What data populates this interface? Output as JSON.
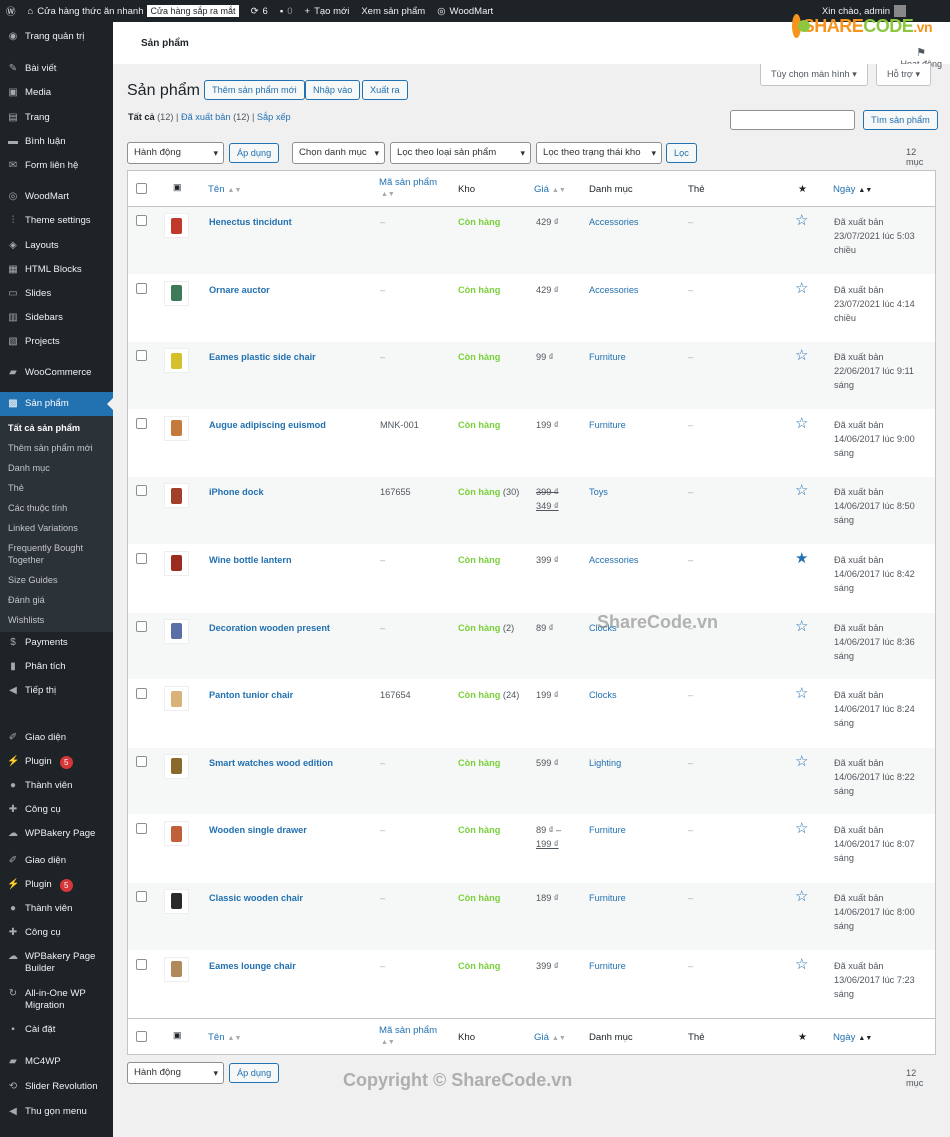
{
  "adminbar": {
    "site_name": "Cửa hàng thức ăn nhanh",
    "status_badge": "Cửa hàng sắp ra mắt",
    "updates_count": "6",
    "comments_count": "0",
    "new_label": "Tạo mới",
    "view_products": "Xem sản phẩm",
    "woodmart": "WoodMart",
    "greeting": "Xin chào, admin"
  },
  "sidebar": {
    "items": [
      {
        "label": "Trang quản trị",
        "icon": "dashboard-icon"
      },
      {
        "label": "Bài viết",
        "icon": "pin-icon"
      },
      {
        "label": "Media",
        "icon": "media-icon"
      },
      {
        "label": "Trang",
        "icon": "page-icon"
      },
      {
        "label": "Bình luận",
        "icon": "comment-icon"
      },
      {
        "label": "Form liên hệ",
        "icon": "mail-icon"
      },
      {
        "label": "WoodMart",
        "icon": "woodmart-icon"
      },
      {
        "label": "Theme settings",
        "icon": "sliders-icon"
      },
      {
        "label": "Layouts",
        "icon": "layers-icon"
      },
      {
        "label": "HTML Blocks",
        "icon": "blocks-icon"
      },
      {
        "label": "Slides",
        "icon": "slides-icon"
      },
      {
        "label": "Sidebars",
        "icon": "sidebars-icon"
      },
      {
        "label": "Projects",
        "icon": "projects-icon"
      },
      {
        "label": "WooCommerce",
        "icon": "woo-icon"
      },
      {
        "label": "Sản phẩm",
        "icon": "archive-icon"
      }
    ],
    "submenu": [
      "Tất cả sản phẩm",
      "Thêm sản phẩm mới",
      "Danh mục",
      "Thẻ",
      "Các thuộc tính",
      "Linked Variations",
      "Frequently Bought Together",
      "Size Guides",
      "Đánh giá",
      "Wishlists"
    ],
    "items2": [
      {
        "label": "Payments",
        "icon": "dollar-icon"
      },
      {
        "label": "Phân tích",
        "icon": "chart-icon"
      },
      {
        "label": "Tiếp thị",
        "icon": "megaphone-icon"
      },
      {
        "label": "Giao diện",
        "icon": "brush-icon"
      },
      {
        "label": "Plugin",
        "icon": "plugin-icon",
        "badge": "5"
      },
      {
        "label": "Thành viên",
        "icon": "user-icon"
      },
      {
        "label": "Công cụ",
        "icon": "wrench-icon"
      },
      {
        "label": "WPBakery Page",
        "icon": "cloud-icon"
      },
      {
        "label": "Giao diện",
        "icon": "brush-icon"
      },
      {
        "label": "Plugin",
        "icon": "plugin-icon",
        "badge": "5"
      },
      {
        "label": "Thành viên",
        "icon": "user-icon"
      },
      {
        "label": "Công cụ",
        "icon": "wrench-icon"
      },
      {
        "label": "WPBakery Page Builder",
        "icon": "cloud-icon"
      },
      {
        "label": "All-in-One WP Migration",
        "icon": "migration-icon"
      },
      {
        "label": "Cài đặt",
        "icon": "settings-icon"
      },
      {
        "label": "MC4WP",
        "icon": "mc4wp-icon"
      },
      {
        "label": "Slider Revolution",
        "icon": "revolution-icon"
      },
      {
        "label": "Thu gọn menu",
        "icon": "collapse-icon"
      }
    ]
  },
  "header": {
    "title": "Sản phẩm",
    "activity": "Hoạt động"
  },
  "logo": {
    "text_a": "SHARE",
    "text_b": "CODE",
    "suffix": ".vn"
  },
  "page": {
    "title": "Sản phẩm",
    "add_new": "Thêm sản phẩm mới",
    "import": "Nhập vào",
    "export": "Xuất ra",
    "screen_options": "Tùy chọn màn hình",
    "help": "Hỗ trợ",
    "views": {
      "all": "Tất cả",
      "all_count": "(12)",
      "published": "Đã xuất bản",
      "published_count": "(12)",
      "sort": "Sắp xếp"
    },
    "search_button": "Tìm sản phẩm",
    "bulk_action": "Hành động",
    "apply": "Áp dụng",
    "category_filter": "Chọn danh mục",
    "type_filter": "Lọc theo loại sản phẩm",
    "stock_filter": "Lọc theo trạng thái kho",
    "filter_button": "Lọc",
    "items_count": "12 mục"
  },
  "table": {
    "headers": {
      "name": "Tên",
      "sku": "Mã sản phẩm",
      "stock": "Kho",
      "price": "Giá",
      "categories": "Danh mục",
      "tags": "Thẻ",
      "date": "Ngày"
    },
    "rows": [
      {
        "name": "Henectus tincidunt",
        "sku": "–",
        "stock": "Còn hàng",
        "stock_qty": "",
        "price": "429 ₫",
        "price2": "",
        "sale": false,
        "category": "Accessories",
        "tags": "–",
        "featured": false,
        "date1": "Đã xuất bản",
        "date2": "23/07/2021 lúc 5:03",
        "date3": "chiều",
        "thumb_color": "#c0392b"
      },
      {
        "name": "Ornare auctor",
        "sku": "–",
        "stock": "Còn hàng",
        "stock_qty": "",
        "price": "429 ₫",
        "price2": "",
        "sale": false,
        "category": "Accessories",
        "tags": "–",
        "featured": false,
        "date1": "Đã xuất bản",
        "date2": "23/07/2021 lúc 4:14",
        "date3": "chiều",
        "thumb_color": "#3c7a5a"
      },
      {
        "name": "Eames plastic side chair",
        "sku": "–",
        "stock": "Còn hàng",
        "stock_qty": "",
        "price": "99 ₫",
        "price2": "",
        "sale": false,
        "category": "Furniture",
        "tags": "–",
        "featured": false,
        "date1": "Đã xuất bản",
        "date2": "22/06/2017 lúc 9:11",
        "date3": "sáng",
        "thumb_color": "#d4c02a"
      },
      {
        "name": "Augue adipiscing euismod",
        "sku": "MNK-001",
        "stock": "Còn hàng",
        "stock_qty": "",
        "price": "199 ₫",
        "price2": "",
        "sale": false,
        "category": "Furniture",
        "tags": "–",
        "featured": false,
        "date1": "Đã xuất bản",
        "date2": "14/06/2017 lúc 9:00",
        "date3": "sáng",
        "thumb_color": "#c47a3a"
      },
      {
        "name": "iPhone dock",
        "sku": "167655",
        "stock": "Còn hàng",
        "stock_qty": "(30)",
        "price": "399 ₫",
        "price2": "349 ₫",
        "sale": true,
        "category": "Toys",
        "tags": "–",
        "featured": false,
        "date1": "Đã xuất bản",
        "date2": "14/06/2017 lúc 8:50",
        "date3": "sáng",
        "thumb_color": "#a0402a"
      },
      {
        "name": "Wine bottle lantern",
        "sku": "–",
        "stock": "Còn hàng",
        "stock_qty": "",
        "price": "399 ₫",
        "price2": "",
        "sale": false,
        "category": "Accessories",
        "tags": "–",
        "featured": true,
        "date1": "Đã xuất bản",
        "date2": "14/06/2017 lúc 8:42",
        "date3": "sáng",
        "thumb_color": "#9b2d20"
      },
      {
        "name": "Decoration wooden present",
        "sku": "–",
        "stock": "Còn hàng",
        "stock_qty": "(2)",
        "price": "89 ₫",
        "price2": "",
        "sale": false,
        "category": "Clocks",
        "tags": "–",
        "featured": false,
        "date1": "Đã xuất bản",
        "date2": "14/06/2017 lúc 8:36",
        "date3": "sáng",
        "thumb_color": "#5a6fa8"
      },
      {
        "name": "Panton tunior chair",
        "sku": "167654",
        "stock": "Còn hàng",
        "stock_qty": "(24)",
        "price": "199 ₫",
        "price2": "",
        "sale": false,
        "category": "Clocks",
        "tags": "–",
        "featured": false,
        "date1": "Đã xuất bản",
        "date2": "14/06/2017 lúc 8:24",
        "date3": "sáng",
        "thumb_color": "#d9b27a"
      },
      {
        "name": "Smart watches wood edition",
        "sku": "–",
        "stock": "Còn hàng",
        "stock_qty": "",
        "price": "599 ₫",
        "price2": "",
        "sale": false,
        "category": "Lighting",
        "tags": "–",
        "featured": false,
        "date1": "Đã xuất bản",
        "date2": "14/06/2017 lúc 8:22",
        "date3": "sáng",
        "thumb_color": "#8a6a2a"
      },
      {
        "name": "Wooden single drawer",
        "sku": "–",
        "stock": "Còn hàng",
        "stock_qty": "",
        "price": "89 ₫ –",
        "price2": "199 ₫",
        "sale": false,
        "category": "Furniture",
        "tags": "–",
        "featured": false,
        "date1": "Đã xuất bản",
        "date2": "14/06/2017 lúc 8:07",
        "date3": "sáng",
        "thumb_color": "#c0603a"
      },
      {
        "name": "Classic wooden chair",
        "sku": "–",
        "stock": "Còn hàng",
        "stock_qty": "",
        "price": "189 ₫",
        "price2": "",
        "sale": false,
        "category": "Furniture",
        "tags": "–",
        "featured": false,
        "date1": "Đã xuất bản",
        "date2": "14/06/2017 lúc 8:00",
        "date3": "sáng",
        "thumb_color": "#2a2a2a"
      },
      {
        "name": "Eames lounge chair",
        "sku": "–",
        "stock": "Còn hàng",
        "stock_qty": "",
        "price": "399 ₫",
        "price2": "",
        "sale": false,
        "category": "Furniture",
        "tags": "–",
        "featured": false,
        "date1": "Đã xuất bản",
        "date2": "13/06/2017 lúc 7:23",
        "date3": "sáng",
        "thumb_color": "#b08a5a"
      }
    ]
  },
  "watermarks": {
    "center": "ShareCode.vn",
    "bottom": "Copyright © ShareCode.vn"
  },
  "colors": {
    "accent": "#2271b1",
    "instock": "#7ad03a",
    "sidebar": "#1d2327",
    "badge": "#d63638"
  }
}
